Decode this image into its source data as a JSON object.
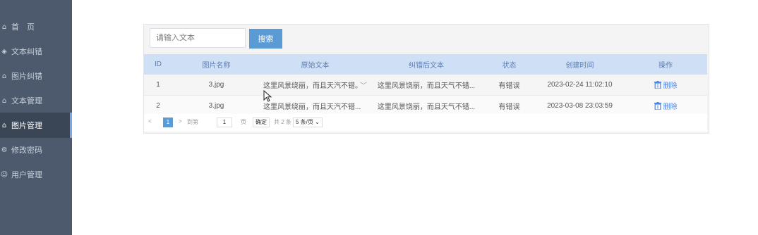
{
  "sidebar": {
    "items": [
      {
        "label": "首　页",
        "icon": "home-icon"
      },
      {
        "label": "文本纠错",
        "icon": "text-icon"
      },
      {
        "label": "图片纠错",
        "icon": "image-icon"
      },
      {
        "label": "文本管理",
        "icon": "folder-icon"
      },
      {
        "label": "图片管理",
        "icon": "folder-icon",
        "active": true
      },
      {
        "label": "修改密码",
        "icon": "gear-icon"
      },
      {
        "label": "用户管理",
        "icon": "user-icon"
      }
    ]
  },
  "search": {
    "placeholder": "请输入文本",
    "button_label": "搜索"
  },
  "table": {
    "headers": [
      "ID",
      "图片名称",
      "原始文本",
      "纠错后文本",
      "状态",
      "创建时间",
      "操作"
    ],
    "rows": [
      {
        "id": "1",
        "name": "3.jpg",
        "original": "这里风景绕丽，而且天汽不错。",
        "corrected": "这里风景饶丽，而且天气不错...",
        "status": "有错误",
        "created": "2023-02-24 11:02:10",
        "action": "删除"
      },
      {
        "id": "2",
        "name": "3.jpg",
        "original": "这里风景绕丽，而且天汽不错...",
        "corrected": "这里风景饶丽，而且天气不错...",
        "status": "有错误",
        "created": "2023-03-08 23:03:59",
        "action": "删除"
      }
    ]
  },
  "pagination": {
    "prev": "<",
    "current": "1",
    "next": ">",
    "goto_label": "到第",
    "page_input": "1",
    "page_suffix": "页",
    "confirm": "确定",
    "total": "共 2 条",
    "page_size": "5 条/页"
  },
  "colors": {
    "sidebar": "#4d5a6d",
    "accent": "#5b9bd5",
    "header_bg": "#cfe0f6"
  }
}
